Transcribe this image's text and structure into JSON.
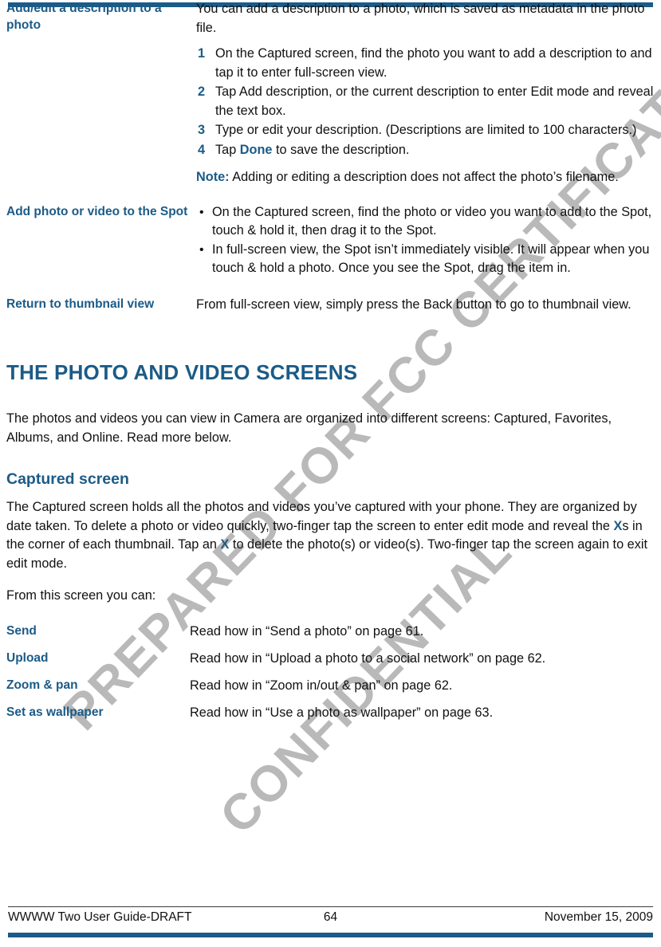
{
  "theme": {
    "accent": "#1b5b87",
    "text": "#111111",
    "watermark": "#b9b9b9",
    "page_bg": "#ffffff"
  },
  "watermark": {
    "line1": "PREPARED FOR FCC CERTIFICATION",
    "line2": "CONFIDENTIAL"
  },
  "definitions": [
    {
      "term": "Add/edit a description to a photo",
      "intro": "You can add a description to a photo, which is saved as metadata in the photo file.",
      "steps": [
        {
          "num": "1",
          "text": "On the Captured screen, find the photo you want to add a description to and tap it to enter full-screen view."
        },
        {
          "num": "2",
          "text": "Tap Add description, or the current description to enter Edit mode and reveal the text box."
        },
        {
          "num": "3",
          "text": "Type or edit your description. (Descriptions are limited to 100 characters.)"
        },
        {
          "num": "4",
          "text": "Tap Done to save the description.",
          "pre": "Tap ",
          "emphasis": "Done",
          "post": " to save the description."
        }
      ],
      "note_label": "Note:",
      "note_text": " Adding or editing a description does not affect the photo’s filename."
    },
    {
      "term": "Add photo or video to the Spot",
      "bullets": [
        "On the Captured screen, find the photo or video you want to add to the Spot, touch & hold it, then drag it to the Spot.",
        "In full-screen view, the Spot isn’t immediately visible. It will appear when you touch & hold a photo. Once you see the Spot, drag the item in."
      ]
    },
    {
      "term": "Return to thumbnail view",
      "body": "From full-screen view, simply press the Back button to go to thumbnail view."
    }
  ],
  "section": {
    "heading": "THE PHOTO AND VIDEO SCREENS",
    "intro": "The photos and videos you can view in Camera are organized into different screens: Captured, Favorites, Albums, and Online. Read more below."
  },
  "subsection": {
    "heading": "Captured screen",
    "para_1_part1": "The Captured screen holds all the photos and videos you’ve captured with your phone. They are organized by date taken. To delete a photo or video quickly, two-finger tap the screen to enter edit mode and reveal the ",
    "para_1_x1": "X",
    "para_1_part2": "s in the corner of each thumbnail. Tap an ",
    "para_1_x2": "X",
    "para_1_part3": " to delete the photo(s) or video(s). Two-finger tap the screen again to exit edit mode.",
    "lead_in": "From this screen you can:"
  },
  "reference_rows": [
    {
      "term": "Send",
      "desc": "Read how in “Send a photo” on page 61."
    },
    {
      "term": "Upload",
      "desc": "Read how in “Upload a photo to a social network” on page 62."
    },
    {
      "term": "Zoom & pan",
      "desc": "Read how in “Zoom in/out & pan” on page 62."
    },
    {
      "term": "Set as wallpaper",
      "desc": "Read how in “Use a photo as wallpaper” on page 63."
    }
  ],
  "footer": {
    "left": "WWWW Two User Guide-DRAFT",
    "page_number": "64",
    "right": "November 15, 2009"
  }
}
